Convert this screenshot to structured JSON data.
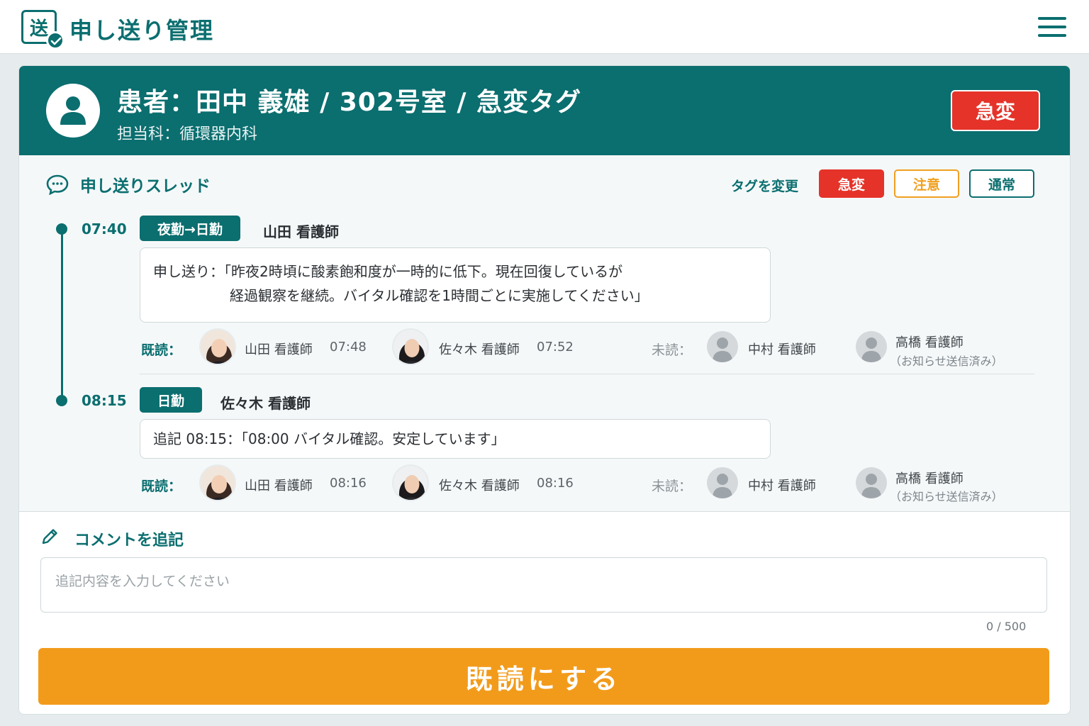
{
  "app": {
    "logo_char": "送",
    "title": "申し送り管理"
  },
  "patient": {
    "title": "患者：田中 義雄 / 302号室 / 急変タグ",
    "department": "担当科：循環器内科",
    "status_badge": "急変"
  },
  "thread": {
    "title": "申し送りスレッド",
    "tag_change_label": "タグを変更",
    "tags": {
      "urgent": "急変",
      "caution": "注意",
      "normal": "通常"
    }
  },
  "entries": [
    {
      "time": "07:40",
      "shift": "夜勤→日勤",
      "author": "山田 看護師",
      "message_line1": "申し送り：「昨夜2時頃に酸素飽和度が一時的に低下。現在回復しているが",
      "message_line2": "経過観察を継続。バイタル確認を1時間ごとに実施してください」",
      "read_label": "既読：",
      "readers": [
        {
          "name": "山田 看護師",
          "time": "07:48"
        },
        {
          "name": "佐々木 看護師",
          "time": "07:52"
        }
      ],
      "unread_label": "未読：",
      "unread": [
        {
          "name": "中村 看護師",
          "note": ""
        },
        {
          "name": "高橋 看護師",
          "note": "（お知らせ送信済み）"
        }
      ]
    },
    {
      "time": "08:15",
      "shift": "日勤",
      "author": "佐々木 看護師",
      "message_line1": "追記 08:15：「08:00 バイタル確認。安定しています」",
      "read_label": "既読：",
      "readers": [
        {
          "name": "山田 看護師",
          "time": "08:16"
        },
        {
          "name": "佐々木 看護師",
          "time": "08:16"
        }
      ],
      "unread_label": "未読：",
      "unread": [
        {
          "name": "中村 看護師",
          "note": ""
        },
        {
          "name": "高橋 看護師",
          "note": "（お知らせ送信済み）"
        }
      ]
    }
  ],
  "comment": {
    "title": "コメントを追記",
    "placeholder": "追記内容を入力してください",
    "count": "0 / 500",
    "submit_label": "既読にする"
  },
  "colors": {
    "primary": "#0b6e6f",
    "urgent": "#e53329",
    "caution": "#f0a020",
    "action": "#f29b1b"
  },
  "icons": [
    "menu-icon",
    "user-icon",
    "chat-icon",
    "pencil-icon",
    "check-icon"
  ]
}
